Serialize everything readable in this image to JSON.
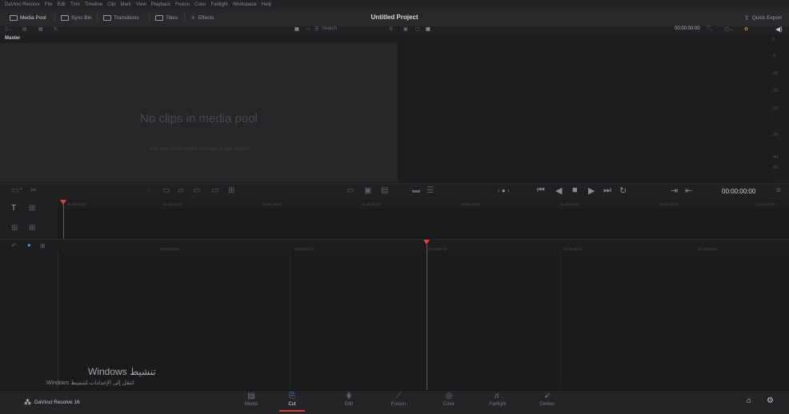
{
  "menu": [
    "DaVinci Resolve",
    "File",
    "Edit",
    "Trim",
    "Timeline",
    "Clip",
    "Mark",
    "View",
    "Playback",
    "Fusion",
    "Color",
    "Fairlight",
    "Workspace",
    "Help"
  ],
  "toolbar": {
    "media_pool": "Media Pool",
    "sync_bin": "Sync Bin",
    "transitions": "Transitions",
    "titles": "Titles",
    "effects": "Effects",
    "quick_export": "Quick Export"
  },
  "project_title": "Untitled Project",
  "search": {
    "placeholder": "Search"
  },
  "media_pool": {
    "bin_name": "Master",
    "empty_title": "No clips in media pool",
    "empty_subtitle": "Add clips from Media Storage to get started"
  },
  "viewer": {
    "timecode_top": "00:00:00:00",
    "timecode_bottom": "00:00:00:00",
    "meter_ticks": [
      "0",
      "-5",
      "-10",
      "-15",
      "-20",
      "-30",
      "-40",
      "-50"
    ]
  },
  "upper_ruler": [
    "01:00:00:00",
    "01:00:10:00",
    "01:00:20:00",
    "01:00:30:00",
    "01:00:40:00",
    "01:00:50:00",
    "01:01:00:00",
    "01:01:10:00"
  ],
  "lower_ruler": [
    "00:59:59:00",
    "00:59:59:12",
    "01:00:00:00",
    "01:00:00:12",
    "01:00:01:00"
  ],
  "watermark": {
    "title": "تنشيط Windows",
    "subtitle": "انتقل إلى الإعدادات لتنشيط Windows."
  },
  "brand": "DaVinci Resolve 16",
  "pages": [
    {
      "label": "Media",
      "icon": "media-page-icon"
    },
    {
      "label": "Cut",
      "icon": "cut-page-icon"
    },
    {
      "label": "Edit",
      "icon": "edit-page-icon"
    },
    {
      "label": "Fusion",
      "icon": "fusion-page-icon"
    },
    {
      "label": "Color",
      "icon": "color-page-icon"
    },
    {
      "label": "Fairlight",
      "icon": "fairlight-page-icon"
    },
    {
      "label": "Deliver",
      "icon": "deliver-page-icon"
    }
  ],
  "colors": {
    "accent": "#d33b38",
    "playhead": "#e2403a",
    "background": "#1b1b1d"
  }
}
